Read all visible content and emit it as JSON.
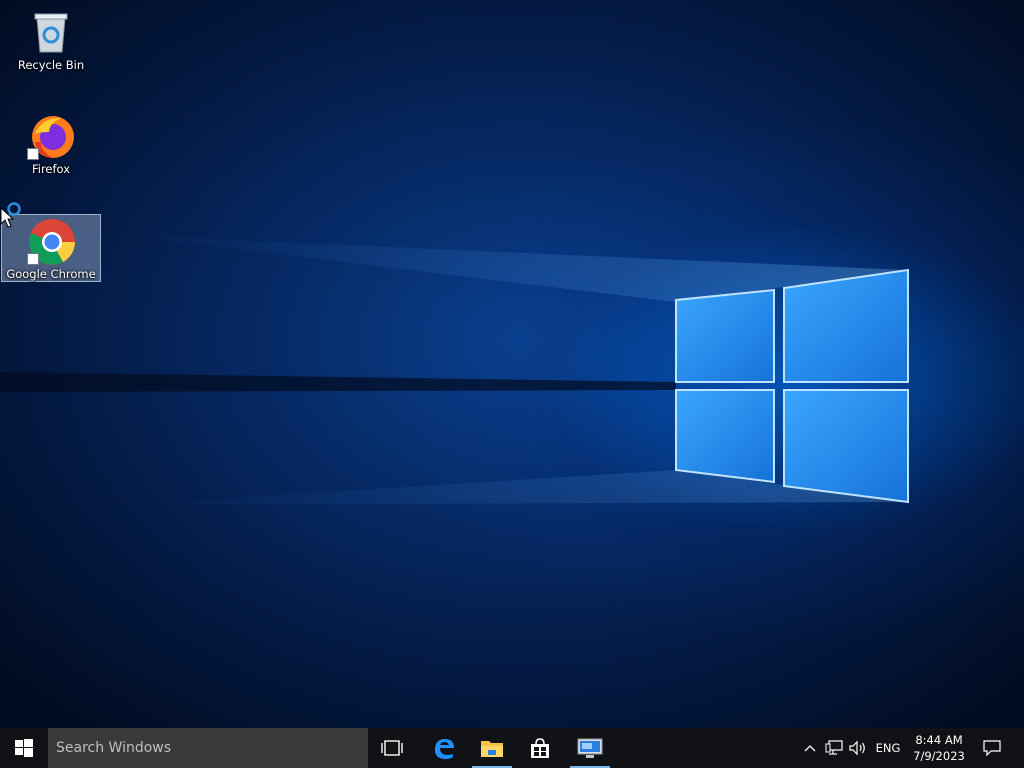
{
  "desktop": {
    "icons": [
      {
        "label": "Recycle Bin",
        "icon": "recycle-bin-icon"
      },
      {
        "label": "Firefox",
        "icon": "firefox-icon"
      },
      {
        "label": "Google Chrome",
        "icon": "chrome-icon",
        "selected": true
      }
    ]
  },
  "taskbar": {
    "search_placeholder": "Search Windows",
    "pinned": [
      {
        "name": "task-view",
        "icon": "task-view-icon"
      },
      {
        "name": "edge",
        "icon": "edge-icon"
      },
      {
        "name": "file-explorer",
        "icon": "folder-icon",
        "running": true
      },
      {
        "name": "store",
        "icon": "store-icon"
      },
      {
        "name": "remote-desktop",
        "icon": "remote-desktop-icon",
        "running": true
      }
    ],
    "tray": {
      "language": "ENG",
      "time": "8:44 AM",
      "date": "7/9/2023"
    }
  },
  "colors": {
    "taskbar_bg": "#101215",
    "search_bg": "#3a3a3a",
    "accent": "#0078d7"
  }
}
